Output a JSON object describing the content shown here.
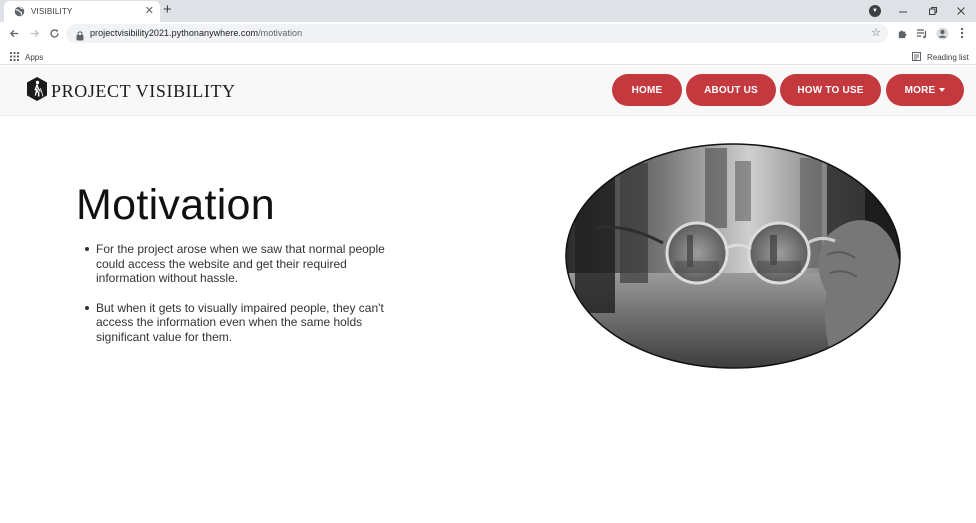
{
  "browser": {
    "tab_title": "VISIBILITY",
    "new_tab": "+",
    "url_domain": "projectvisibility2021.pythonanywhere.com",
    "url_path": "/motivation",
    "bookmarks": {
      "apps_label": "Apps",
      "reading_list_label": "Reading list"
    }
  },
  "site": {
    "logo_text": "PROJECT VISIBILITY",
    "nav": {
      "home": "HOME",
      "about": "ABOUT US",
      "howto": "HOW TO USE",
      "more": "MORE"
    },
    "accent_color": "#c4393e"
  },
  "content": {
    "title": "Motivation",
    "points": [
      "For the project arose when we saw that normal people could access the website and get their required information without hassle.",
      "But when it gets to visually impaired people, they can't access the information even when the same holds significant value for them."
    ]
  },
  "icons": {
    "favicon": "globe-icon",
    "logo": "walking-person-hexagon-icon",
    "hero": "eyeglasses-photo"
  }
}
